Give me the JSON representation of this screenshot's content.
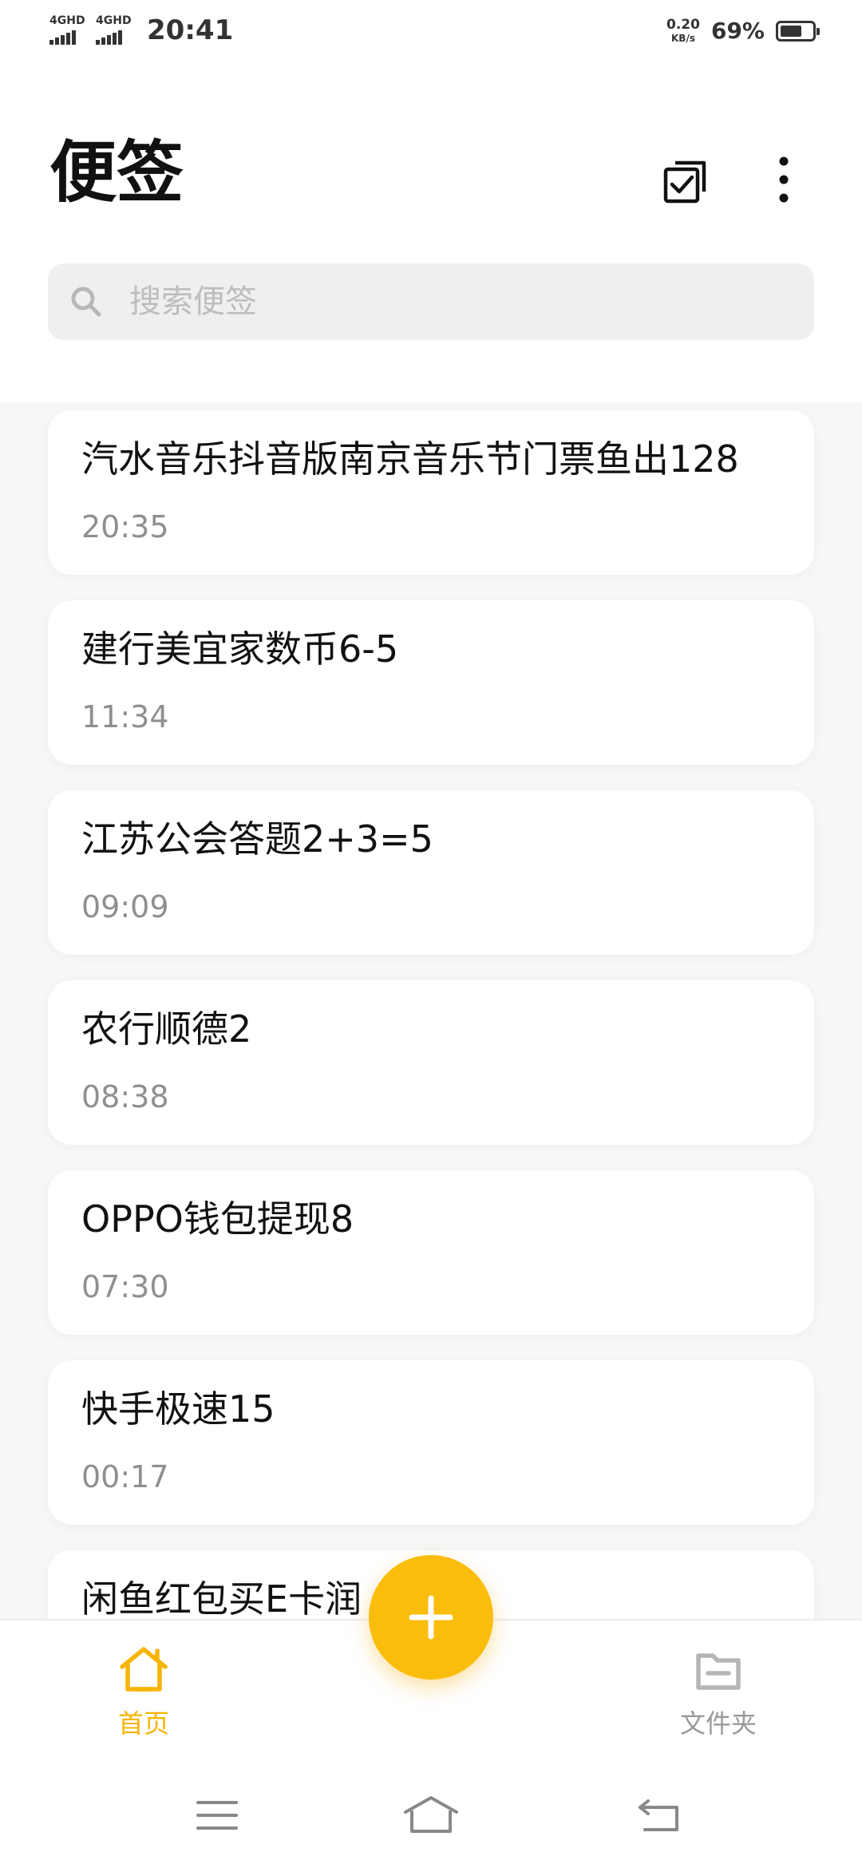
{
  "status_bar": {
    "sim1_label": "4GHD",
    "sim2_label": "4GHD",
    "time": "20:41",
    "net_speed_value": "0.20",
    "net_speed_unit": "KB/s",
    "battery_percent": "69%",
    "battery_level": 0.69
  },
  "header": {
    "title": "便签",
    "select_icon": "multi-select-checkbox-icon",
    "more_icon": "more-vertical-icon"
  },
  "search": {
    "placeholder": "搜索便签",
    "icon": "search-icon"
  },
  "notes": [
    {
      "title": "汽水音乐抖音版南京音乐节门票鱼出128",
      "time": "20:35"
    },
    {
      "title": "建行美宜家数币6-5",
      "time": "11:34"
    },
    {
      "title": "江苏公会答题2+3=5",
      "time": "09:09"
    },
    {
      "title": "农行顺德2",
      "time": "08:38"
    },
    {
      "title": "OPPO钱包提现8",
      "time": "07:30"
    },
    {
      "title": "快手极速15",
      "time": "00:17"
    },
    {
      "title": "闲鱼红包买E卡润",
      "time": ""
    }
  ],
  "bottom_nav": {
    "home_label": "首页",
    "folder_label": "文件夹",
    "home_icon": "home-icon",
    "folder_icon": "folder-icon",
    "fab_icon": "plus-icon"
  },
  "colors": {
    "accent": "#fbbd0c",
    "accent_text": "#f7b400",
    "muted": "#8f8f8f",
    "background": "#f7f7f7"
  }
}
